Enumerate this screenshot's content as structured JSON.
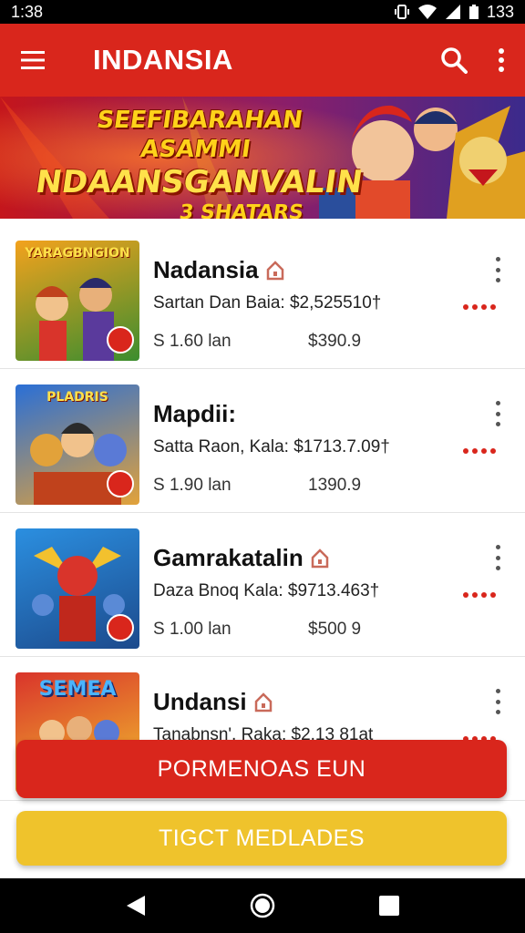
{
  "status_bar": {
    "time": "1:38",
    "battery": "133"
  },
  "app_bar": {
    "title": "INDANSIA",
    "menu_icon": "hamburger-icon",
    "search_icon": "search-icon",
    "more_icon": "more-vert-icon"
  },
  "banner": {
    "line1": "SEEFIBARAHAN ASAMMI",
    "line2": "NDAANSGANVALIN",
    "line3": "3 SHATARS"
  },
  "items": [
    {
      "thumb_title": "YARAGBNGION",
      "title": "Nadansia",
      "has_tag": true,
      "description": "Sartan Dan Baia: $2,525510†",
      "left_value": "S 1.60 lan",
      "right_value": "$390.9",
      "thumb_colors": [
        "#f3a21d",
        "#3c8d2f"
      ]
    },
    {
      "thumb_title": "PLADRIS",
      "title": "Mapdii:",
      "has_tag": false,
      "description": "Satta Raon, Kala: $1713.7.09†",
      "left_value": "S 1.90 lan",
      "right_value": "1390.9",
      "thumb_colors": [
        "#2a6fd6",
        "#e2a23a"
      ]
    },
    {
      "thumb_title": "",
      "title": "Gamrakatalin",
      "has_tag": true,
      "description": "Daza Bnoq Kala: $9713.463†",
      "left_value": "S 1.00 lan",
      "right_value": "$500 9",
      "thumb_colors": [
        "#2b8fe0",
        "#1c4a8c"
      ]
    },
    {
      "thumb_title": "SEMEA",
      "title": "Undansi",
      "has_tag": true,
      "description": "Tanabnsn', Raka: $2.13 81at",
      "left_value": "",
      "right_value": "",
      "thumb_colors": [
        "#d9342b",
        "#f2c12e"
      ]
    }
  ],
  "buttons": {
    "primary": "PORMENOAS EUN",
    "secondary": "TIGCT MEDLADES"
  },
  "colors": {
    "accent": "#d9261c",
    "secondary": "#efc32c"
  },
  "nav": {
    "back_icon": "back-triangle-icon",
    "home_icon": "home-circle-icon",
    "recents_icon": "recents-square-icon"
  }
}
